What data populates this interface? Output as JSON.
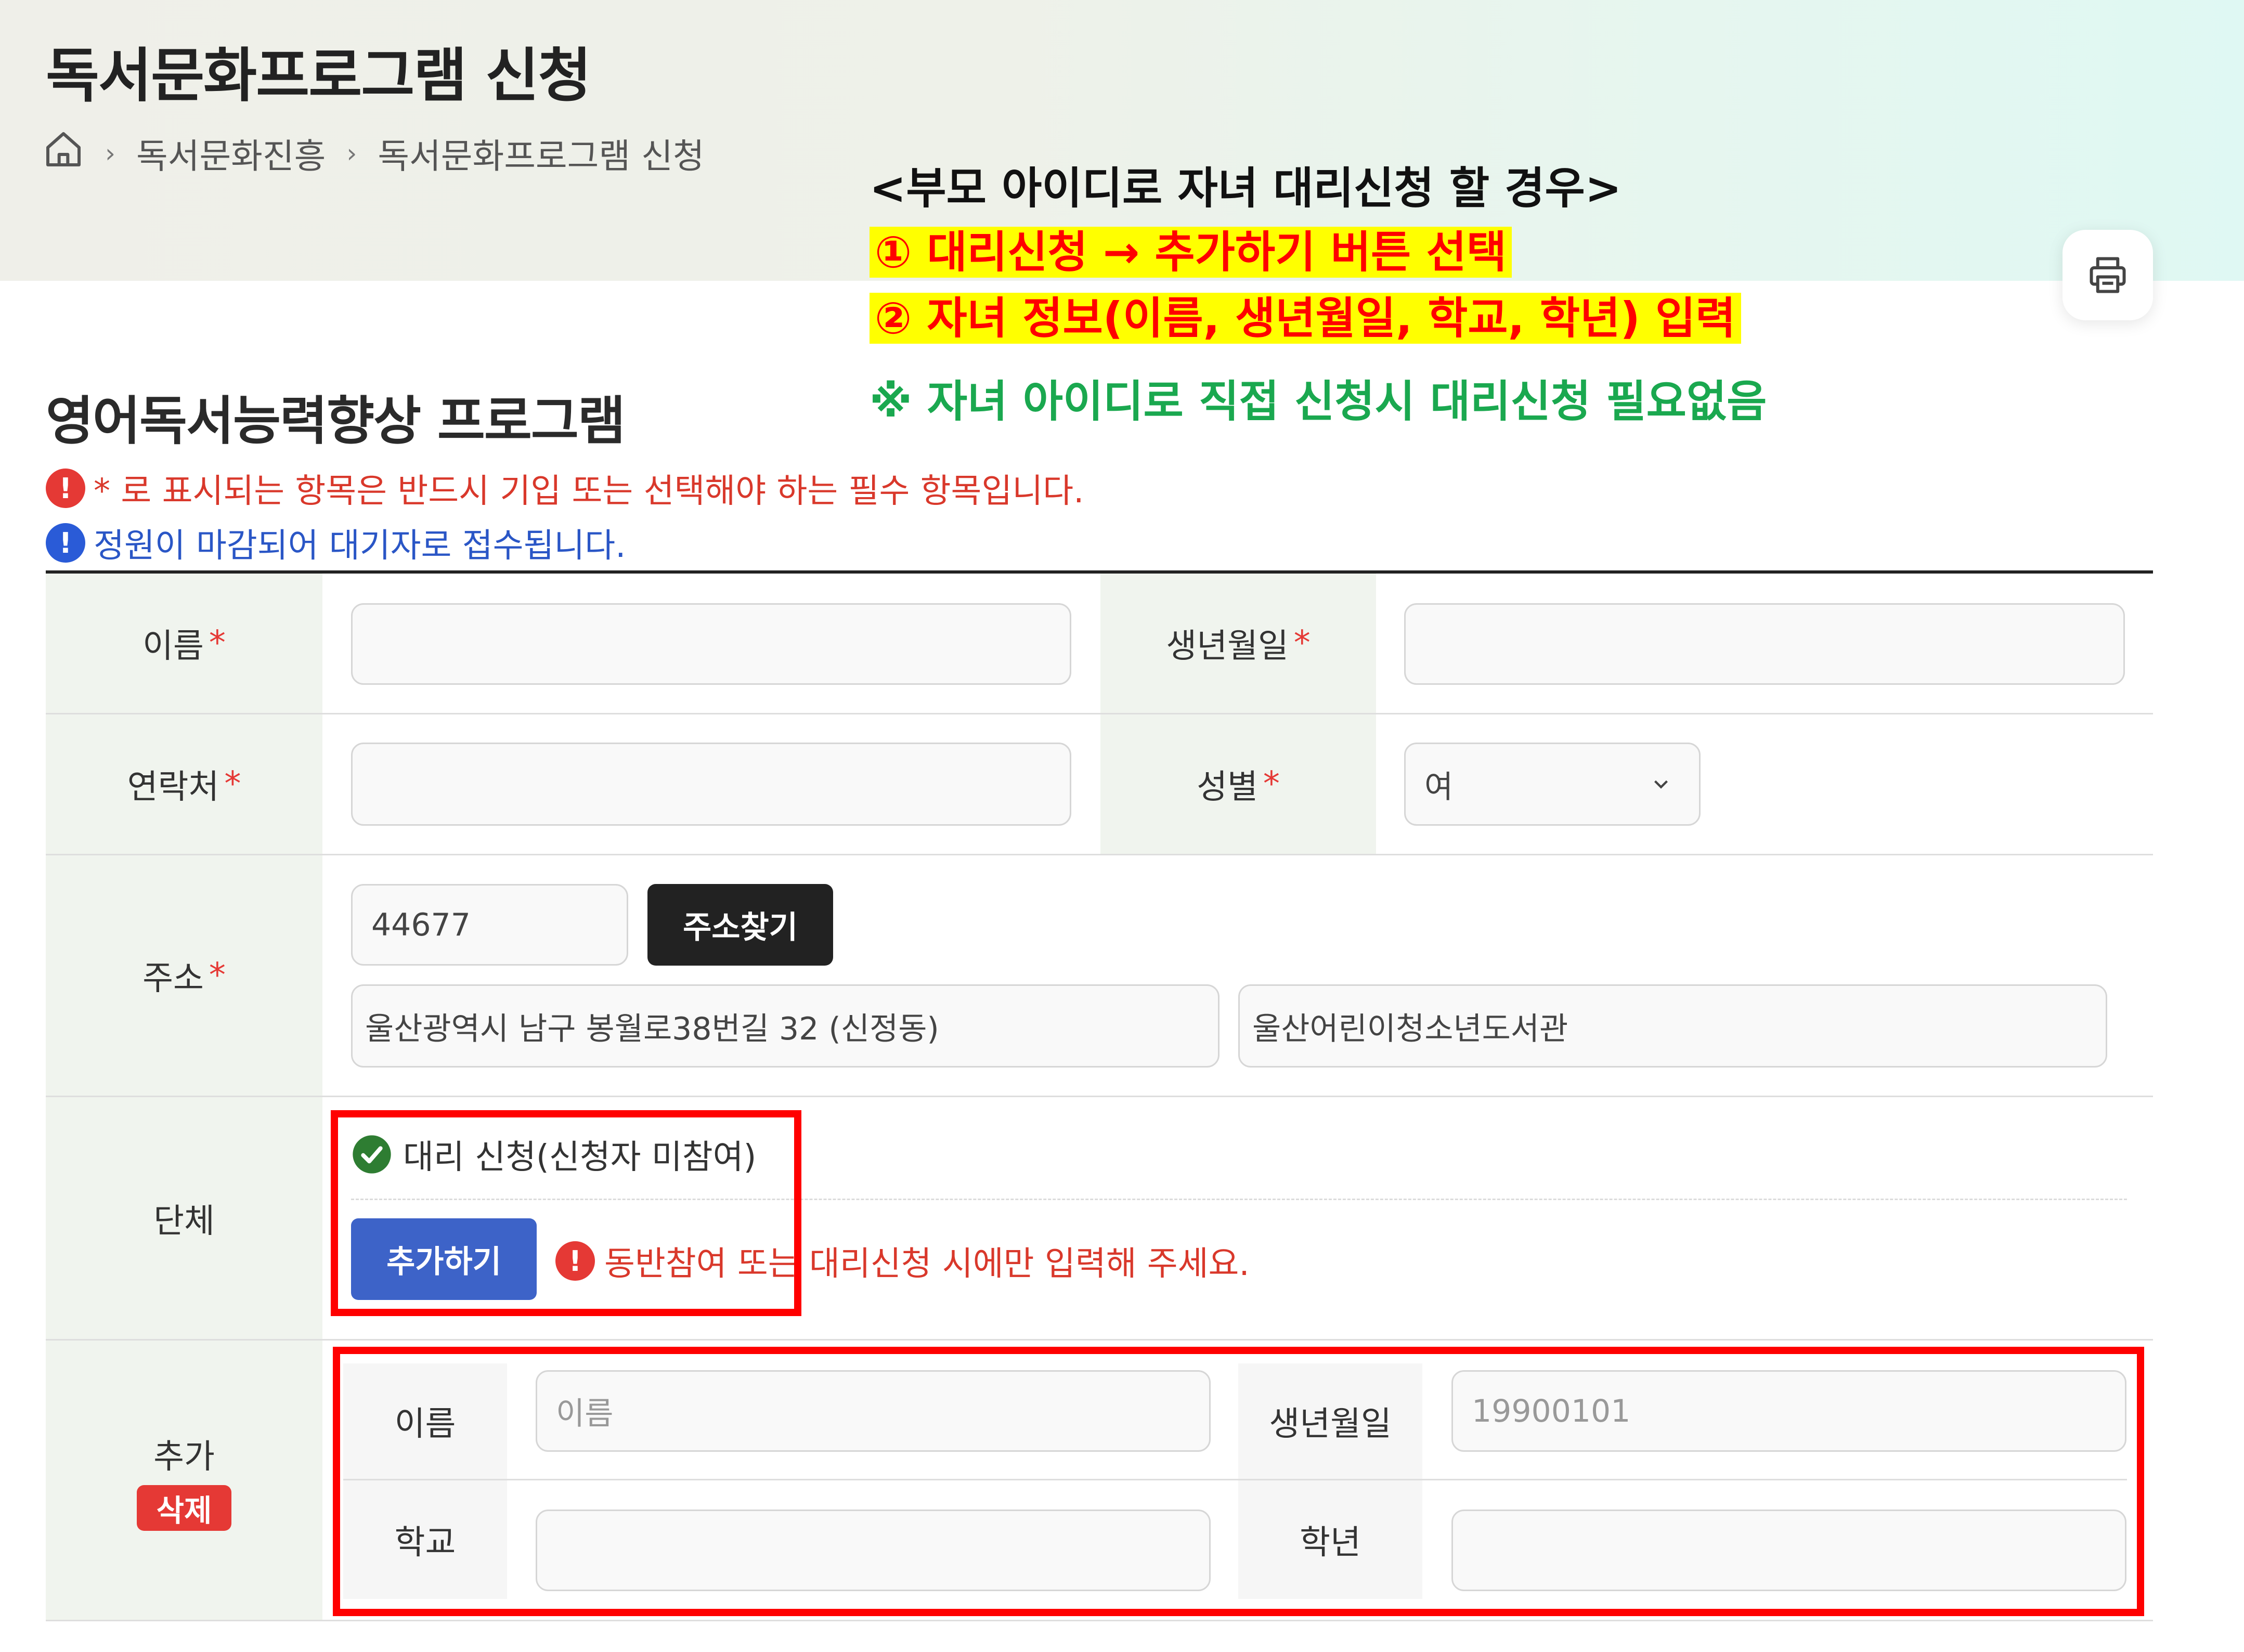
{
  "header": {
    "title": "독서문화프로그램 신청",
    "breadcrumb": [
      "독서문화진흥",
      "독서문화프로그램 신청"
    ]
  },
  "annotations": {
    "line1": "<부모 아이디로 자녀 대리신청 할 경우>",
    "line2": "① 대리신청 → 추가하기 버튼 선택",
    "line3": "② 자녀 정보(이름, 생년월일, 학교, 학년) 입력",
    "line4": "※ 자녀 아이디로 직접 신청시 대리신청 필요없음"
  },
  "program": {
    "title": "영어독서능력향상 프로그램",
    "notice_required": "* 로 표시되는 항목은 반드시 기입 또는 선택해야 하는 필수 항목입니다.",
    "notice_waitlist": "정원이 마감되어 대기자로 접수됩니다."
  },
  "form": {
    "required_mark": "*",
    "name_label": "이름",
    "birth_label": "생년월일",
    "phone_label": "연락처",
    "gender_label": "성별",
    "gender_value": "여",
    "address_label": "주소",
    "zipcode": "44677",
    "address_search_button": "주소찾기",
    "address_main": "울산광역시 남구 봉월로38번길 32 (신정동)",
    "address_detail": "울산어린이청소년도서관",
    "group_label": "단체",
    "proxy_option": "대리 신청(신청자 미참여)",
    "add_button": "추가하기",
    "proxy_hint": "동반참여 또는 대리신청 시에만 입력해 주세요.",
    "added_label": "추가",
    "delete_button": "삭제",
    "child_name_label": "이름",
    "child_name_placeholder": "이름",
    "child_birth_label": "생년월일",
    "child_birth_placeholder": "19900101",
    "child_school_label": "학교",
    "child_grade_label": "학년"
  },
  "colors": {
    "label_bg": "#f0f4ee",
    "required": "#e53935",
    "blue_button": "#3d63c8",
    "annotation_highlight": "#ffff00",
    "annotation_red": "#ff0000",
    "annotation_green": "#1aa84f"
  }
}
